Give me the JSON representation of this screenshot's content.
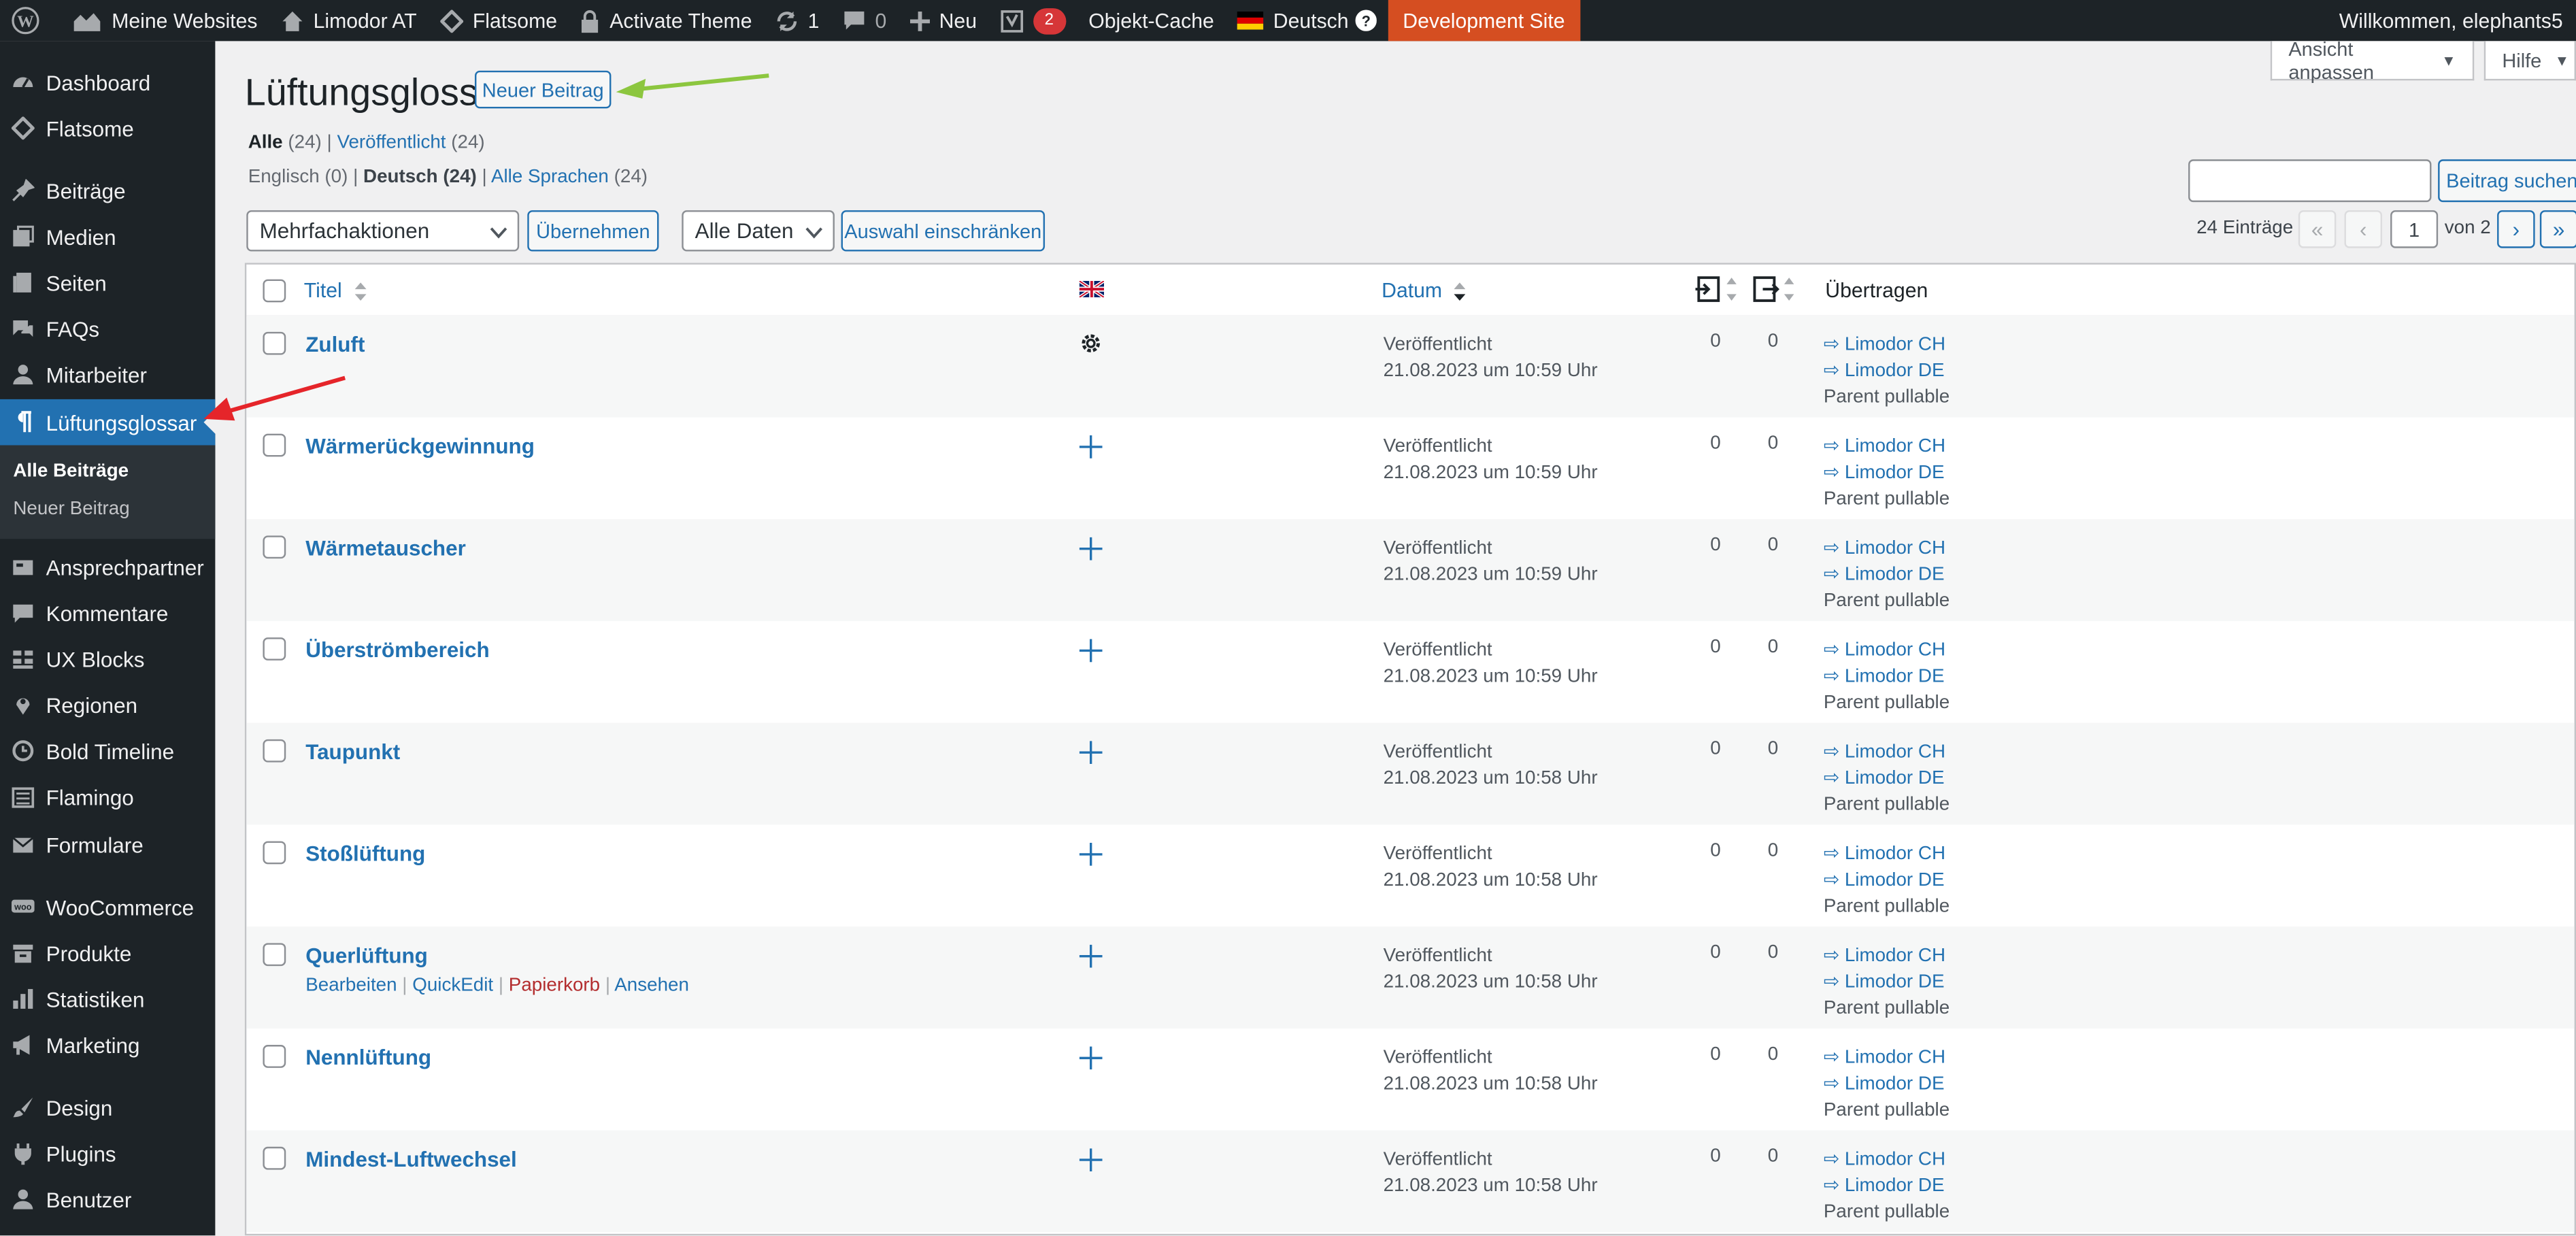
{
  "adminbar": {
    "items": [
      {
        "label": "Meine Websites"
      },
      {
        "label": "Limodor AT"
      },
      {
        "label": "Flatsome"
      },
      {
        "label": "Activate Theme"
      },
      {
        "label": "1"
      },
      {
        "label": "0"
      },
      {
        "label": "Neu"
      },
      {
        "label": "2"
      },
      {
        "label": "Objekt-Cache"
      },
      {
        "label": "Deutsch"
      },
      {
        "label": "Development Site"
      }
    ],
    "greeting": "Willkommen, elephants5"
  },
  "sidebar": {
    "items": [
      {
        "label": "Dashboard"
      },
      {
        "label": "Flatsome"
      },
      {
        "label": "Beiträge"
      },
      {
        "label": "Medien"
      },
      {
        "label": "Seiten"
      },
      {
        "label": "FAQs"
      },
      {
        "label": "Mitarbeiter"
      },
      {
        "label": "Lüftungsglossar"
      },
      {
        "label": "Ansprechpartner"
      },
      {
        "label": "Kommentare"
      },
      {
        "label": "UX Blocks"
      },
      {
        "label": "Regionen"
      },
      {
        "label": "Bold Timeline"
      },
      {
        "label": "Flamingo"
      },
      {
        "label": "Formulare"
      },
      {
        "label": "WooCommerce"
      },
      {
        "label": "Produkte"
      },
      {
        "label": "Statistiken"
      },
      {
        "label": "Marketing"
      },
      {
        "label": "Design"
      },
      {
        "label": "Plugins"
      },
      {
        "label": "Benutzer"
      }
    ],
    "submenu": [
      "Alle Beiträge",
      "Neuer Beitrag"
    ]
  },
  "screen": {
    "options": "Ansicht anpassen",
    "help": "Hilfe"
  },
  "page": {
    "title": "Lüftungsglossar",
    "new_button": "Neuer Beitrag"
  },
  "status_filter": {
    "all": "Alle",
    "all_count": "(24)",
    "published": "Veröffentlicht",
    "published_count": "(24)"
  },
  "lang_filter": {
    "english": "Englisch",
    "english_count": "(0)",
    "deutsch": "Deutsch",
    "deutsch_count": "(24)",
    "all_lang": "Alle Sprachen",
    "all_lang_count": "(24)"
  },
  "toolbar": {
    "bulk": "Mehrfachaktionen",
    "apply": "Übernehmen",
    "dates": "Alle Daten",
    "filter": "Auswahl einschränken",
    "search_button": "Beitrag suchen",
    "items_count": "24 Einträge",
    "page_current": "1",
    "page_of": "von 2",
    "first": "«",
    "prev": "‹",
    "next": "›",
    "last": "»"
  },
  "table": {
    "columns": {
      "title": "Titel",
      "date": "Datum",
      "translate": "Übertragen"
    },
    "rows": [
      {
        "title": "Zuluft",
        "status": "Veröffentlicht",
        "date": "21.08.2023 um 10:59 Uhr",
        "c1": "0",
        "c2": "0",
        "t1": "⇨ Limodor CH",
        "t2": "⇨ Limodor DE",
        "t3": "Parent pullable",
        "lang_icon": "gear-icon"
      },
      {
        "title": "Wärmerückgewinnung",
        "status": "Veröffentlicht",
        "date": "21.08.2023 um 10:59 Uhr",
        "c1": "0",
        "c2": "0",
        "t1": "⇨ Limodor CH",
        "t2": "⇨ Limodor DE",
        "t3": "Parent pullable",
        "lang_icon": "plus-icon"
      },
      {
        "title": "Wärmetauscher",
        "status": "Veröffentlicht",
        "date": "21.08.2023 um 10:59 Uhr",
        "c1": "0",
        "c2": "0",
        "t1": "⇨ Limodor CH",
        "t2": "⇨ Limodor DE",
        "t3": "Parent pullable",
        "lang_icon": "plus-icon"
      },
      {
        "title": "Überströmbereich",
        "status": "Veröffentlicht",
        "date": "21.08.2023 um 10:59 Uhr",
        "c1": "0",
        "c2": "0",
        "t1": "⇨ Limodor CH",
        "t2": "⇨ Limodor DE",
        "t3": "Parent pullable",
        "lang_icon": "plus-icon"
      },
      {
        "title": "Taupunkt",
        "status": "Veröffentlicht",
        "date": "21.08.2023 um 10:58 Uhr",
        "c1": "0",
        "c2": "0",
        "t1": "⇨ Limodor CH",
        "t2": "⇨ Limodor DE",
        "t3": "Parent pullable",
        "lang_icon": "plus-icon"
      },
      {
        "title": "Stoßlüftung",
        "status": "Veröffentlicht",
        "date": "21.08.2023 um 10:58 Uhr",
        "c1": "0",
        "c2": "0",
        "t1": "⇨ Limodor CH",
        "t2": "⇨ Limodor DE",
        "t3": "Parent pullable",
        "lang_icon": "plus-icon"
      },
      {
        "title": "Querlüftung",
        "status": "Veröffentlicht",
        "date": "21.08.2023 um 10:58 Uhr",
        "c1": "0",
        "c2": "0",
        "t1": "⇨ Limodor CH",
        "t2": "⇨ Limodor DE",
        "t3": "Parent pullable",
        "lang_icon": "plus-icon"
      },
      {
        "title": "Nennlüftung",
        "status": "Veröffentlicht",
        "date": "21.08.2023 um 10:58 Uhr",
        "c1": "0",
        "c2": "0",
        "t1": "⇨ Limodor CH",
        "t2": "⇨ Limodor DE",
        "t3": "Parent pullable",
        "lang_icon": "plus-icon"
      },
      {
        "title": "Mindest-Luftwechsel",
        "status": "Veröffentlicht",
        "date": "21.08.2023 um 10:58 Uhr",
        "c1": "0",
        "c2": "0",
        "t1": "⇨ Limodor CH",
        "t2": "⇨ Limodor DE",
        "t3": "Parent pullable",
        "lang_icon": "plus-icon"
      }
    ],
    "row_actions": {
      "edit": "Bearbeiten",
      "quickedit": "QuickEdit",
      "trash": "Papierkorb",
      "view": "Ansehen"
    }
  },
  "colors": {
    "accent": "#2271b1",
    "admin_bg": "#1d2327",
    "dev_site": "#d54e21",
    "arrow_red": "#e5252a",
    "arrow_green": "#8cc63f"
  }
}
